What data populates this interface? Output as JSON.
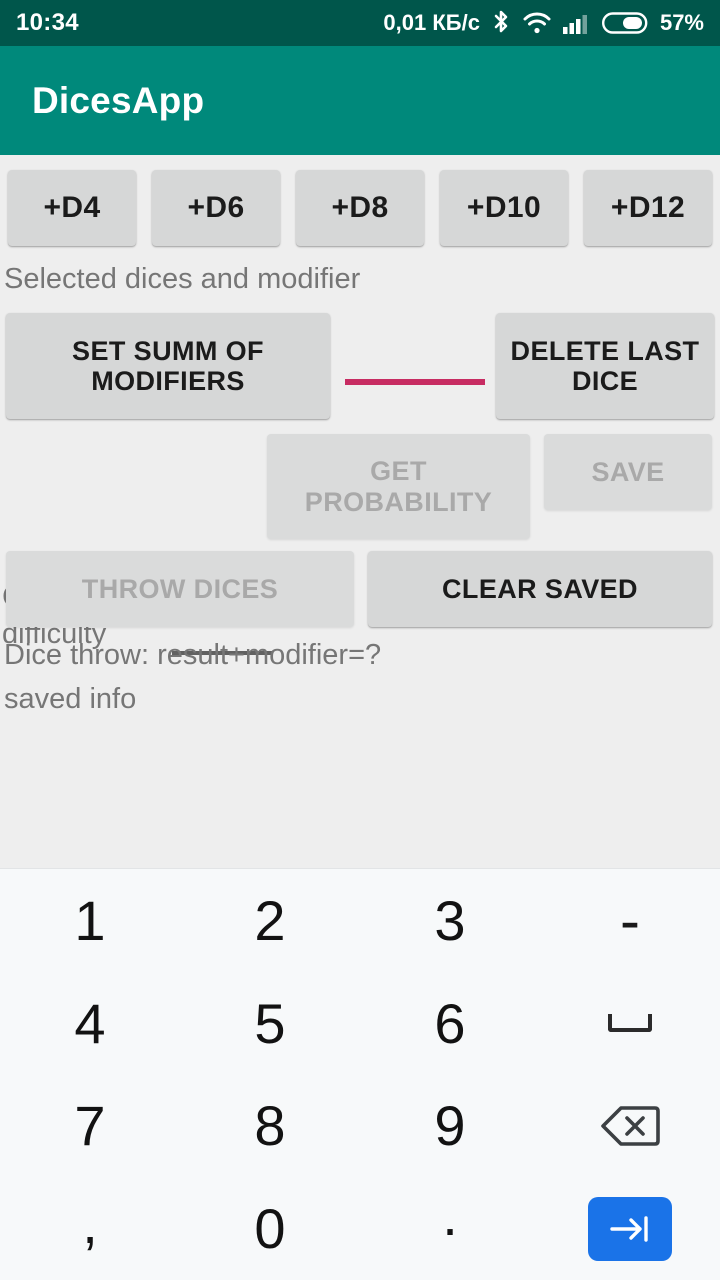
{
  "status_bar": {
    "clock": "10:34",
    "net_speed": "0,01 КБ/с",
    "battery_percent": "57%",
    "icons": [
      "bluetooth-icon",
      "wifi-icon",
      "cellular-signal-icon",
      "battery-icon"
    ],
    "background_color": "#00564B",
    "foreground_color": "#FFFFFF"
  },
  "app_bar": {
    "title": "DicesApp",
    "background_color": "#00897B",
    "title_color": "#FFFFFF"
  },
  "theme": {
    "window_background": "#EEEEEE",
    "button_background": "#D6D7D7",
    "button_disabled_background": "#DADBDB",
    "button_text": "#1B1B1B",
    "button_disabled_text": "#A9A9A9",
    "accent_color": "#C72C62",
    "muted_text": "#767676",
    "edit_underline_color": "#616161",
    "keyboard_background": "#F7F9FA",
    "enter_key_color": "#1A73E8"
  },
  "main": {
    "dice_buttons": [
      {
        "label": "+D4",
        "enabled": true
      },
      {
        "label": "+D6",
        "enabled": true
      },
      {
        "label": "+D8",
        "enabled": true
      },
      {
        "label": "+D10",
        "enabled": true
      },
      {
        "label": "+D12",
        "enabled": true
      }
    ],
    "selected_dices_label": "Selected dices and modifier",
    "set_summ_button": "SET SUMM OF MODIFIERS",
    "delete_last_dice_button": "DELETE LAST DICE",
    "modifier_input": {
      "value": "",
      "focused": true
    },
    "check_difficulty_label": "Check difficulty",
    "difficulty_input": {
      "value": "",
      "focused": false
    },
    "get_probability_button": "GET PROBABILITY",
    "save_button": "SAVE",
    "throw_dices_button": "THROW DICES",
    "clear_saved_button": "CLEAR SAVED",
    "dice_throw_result": "Dice throw: result+modifier=?",
    "saved_info": "saved info"
  },
  "keyboard": {
    "type": "numeric",
    "rows": [
      [
        {
          "label": "1",
          "name": "key-1"
        },
        {
          "label": "2",
          "name": "key-2"
        },
        {
          "label": "3",
          "name": "key-3"
        },
        {
          "label": "-",
          "name": "key-minus"
        }
      ],
      [
        {
          "label": "4",
          "name": "key-4"
        },
        {
          "label": "5",
          "name": "key-5"
        },
        {
          "label": "6",
          "name": "key-6"
        },
        {
          "label": "",
          "name": "key-space"
        }
      ],
      [
        {
          "label": "7",
          "name": "key-7"
        },
        {
          "label": "8",
          "name": "key-8"
        },
        {
          "label": "9",
          "name": "key-9"
        },
        {
          "label": "",
          "name": "key-backspace"
        }
      ],
      [
        {
          "label": ",",
          "name": "key-comma"
        },
        {
          "label": "0",
          "name": "key-0"
        },
        {
          "label": ".",
          "name": "key-period"
        },
        {
          "label": "",
          "name": "key-enter-next"
        }
      ]
    ]
  }
}
